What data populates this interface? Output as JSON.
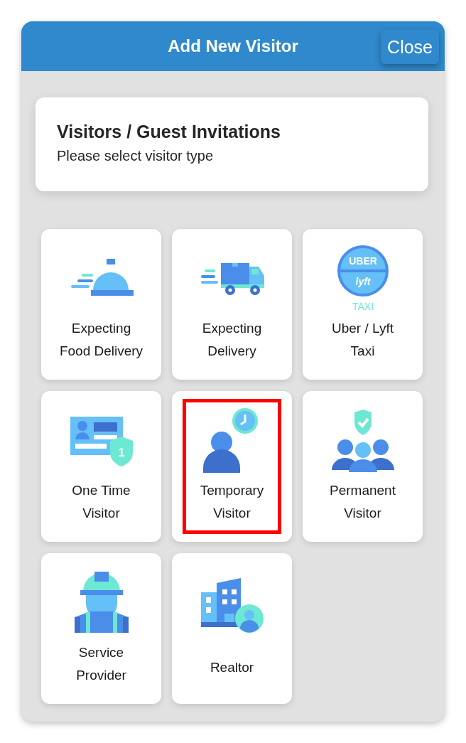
{
  "window": {
    "title": "Add New Visitor",
    "close_button": "Close"
  },
  "intro": {
    "title": "Visitors / Guest Invitations",
    "subtitle": "Please select visitor type"
  },
  "tiles": [
    {
      "kind": "food",
      "label": [
        "Expecting",
        "Food Delivery"
      ],
      "selected": false
    },
    {
      "kind": "truck",
      "label": [
        "Expecting",
        "Delivery"
      ],
      "selected": false
    },
    {
      "kind": "taxi",
      "label": [
        "Uber / Lyft",
        "Taxi"
      ],
      "icon_texts": [
        "UBER",
        "lyft",
        "TAXI"
      ],
      "selected": false
    },
    {
      "kind": "idcard",
      "label": [
        "One Time",
        "Visitor"
      ],
      "icon_texts": [
        "1"
      ],
      "selected": false
    },
    {
      "kind": "clockperson",
      "label": [
        "Temporary",
        "Visitor"
      ],
      "selected": true
    },
    {
      "kind": "group",
      "label": [
        "Permanent",
        "Visitor"
      ],
      "selected": false
    },
    {
      "kind": "worker",
      "label": [
        "Service",
        "Provider"
      ],
      "selected": false
    },
    {
      "kind": "building",
      "label": [
        "Realtor"
      ],
      "selected": false
    }
  ]
}
